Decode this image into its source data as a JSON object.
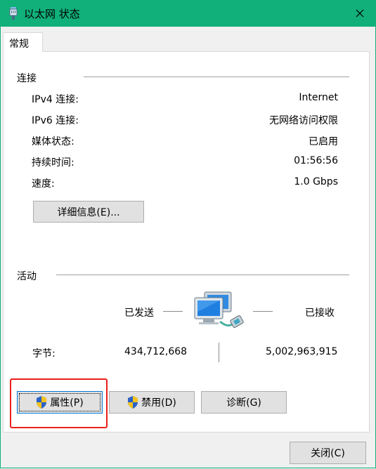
{
  "window": {
    "title": "以太网 状态",
    "tab_general": "常规"
  },
  "connection": {
    "section_title": "连接",
    "rows": [
      {
        "label": "IPv4 连接:",
        "value": "Internet"
      },
      {
        "label": "IPv6 连接:",
        "value": "无网络访问权限"
      },
      {
        "label": "媒体状态:",
        "value": "已启用"
      },
      {
        "label": "持续时间:",
        "value": "01:56:56"
      },
      {
        "label": "速度:",
        "value": "1.0 Gbps"
      }
    ],
    "details_button": "详细信息(E)..."
  },
  "activity": {
    "section_title": "活动",
    "sent_label": "已发送",
    "received_label": "已接收",
    "bytes_label": "字节:",
    "bytes_sent": "434,712,668",
    "bytes_received": "5,002,963,915"
  },
  "actions": {
    "properties_button": "属性(P)",
    "disable_button": "禁用(D)",
    "diagnose_button": "诊断(G)",
    "close_button": "关闭(C)"
  },
  "icons": {
    "title_icon": "ethernet-plug-icon",
    "network_icon": "network-computers-icon",
    "shield_icon": "uac-shield-icon",
    "close_icon": "close-icon"
  },
  "colors": {
    "titlebar": "#11b07a",
    "highlight": "#e8201a",
    "button_face": "#e1e1e1",
    "focus_border": "#0078d7"
  }
}
